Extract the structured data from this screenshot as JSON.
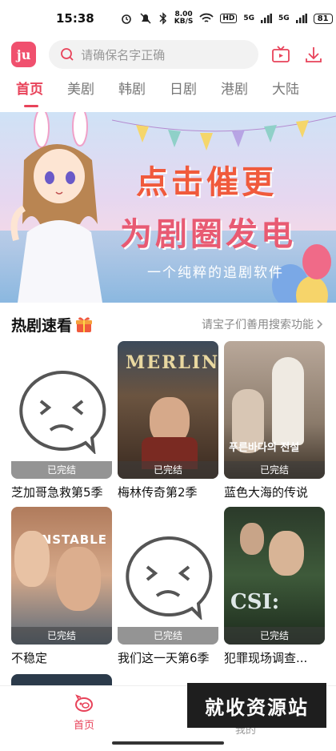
{
  "status_bar": {
    "time": "15:38",
    "net_speed_top": "8.00",
    "net_speed_unit": "KB/S",
    "hd_label": "HD",
    "signal_1": "5G",
    "signal_2": "5G",
    "battery": "81"
  },
  "header": {
    "logo_text": "ju",
    "search_placeholder": "请确保名字正确"
  },
  "tabs": [
    {
      "label": "首页",
      "active": true
    },
    {
      "label": "美剧",
      "active": false
    },
    {
      "label": "韩剧",
      "active": false
    },
    {
      "label": "日剧",
      "active": false
    },
    {
      "label": "港剧",
      "active": false
    },
    {
      "label": "大陆",
      "active": false
    }
  ],
  "banner": {
    "line1": "点击催更",
    "line2": "为剧圈发电",
    "line3": "一个纯粹的追剧软件"
  },
  "section": {
    "title": "热剧速看",
    "more": "请宝子们善用搜索功能"
  },
  "cards": [
    {
      "title": "芝加哥急救第5季",
      "badge": "已完结",
      "poster": "placeholder"
    },
    {
      "title": "梅林传奇第2季",
      "badge": "已完结",
      "poster": "merlin",
      "poster_text": "MERLIN"
    },
    {
      "title": "蓝色大海的传说",
      "badge": "已完结",
      "poster": "legend",
      "poster_text": "푸른바다의 전설"
    },
    {
      "title": "不稳定",
      "badge": "已完结",
      "poster": "unstable",
      "poster_text": "UNSTABLE"
    },
    {
      "title": "我们这一天第6季",
      "badge": "已完结",
      "poster": "placeholder"
    },
    {
      "title": "犯罪现场调查...",
      "badge": "已完结",
      "poster": "csi",
      "poster_text": "CSI:"
    }
  ],
  "bottom_nav": {
    "home_label": "首页",
    "other_label": "我的"
  },
  "watermark": "就收资源站",
  "colors": {
    "accent": "#e8435a",
    "logo_bg": "#f0506e"
  }
}
